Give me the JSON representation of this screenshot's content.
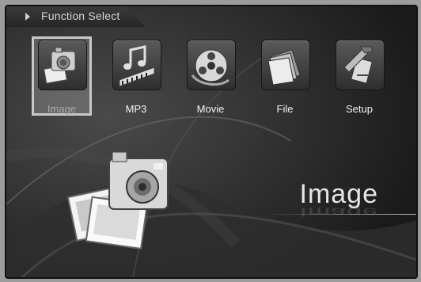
{
  "header": {
    "title": "Function Select",
    "arrow_icon": "play-arrow-icon"
  },
  "menu": {
    "items": [
      {
        "label": "Image",
        "icon": "camera-photo-icon",
        "selected": true
      },
      {
        "label": "MP3",
        "icon": "music-note-icon",
        "selected": false
      },
      {
        "label": "Movie",
        "icon": "film-reel-icon",
        "selected": false
      },
      {
        "label": "File",
        "icon": "files-icon",
        "selected": false
      },
      {
        "label": "Setup",
        "icon": "tools-icon",
        "selected": false
      }
    ]
  },
  "preview": {
    "title": "Image",
    "icon": "camera-photo-icon"
  },
  "colors": {
    "background": "#1f1f1f",
    "text": "#f2f2f2",
    "selection": "#c8c8c8"
  }
}
